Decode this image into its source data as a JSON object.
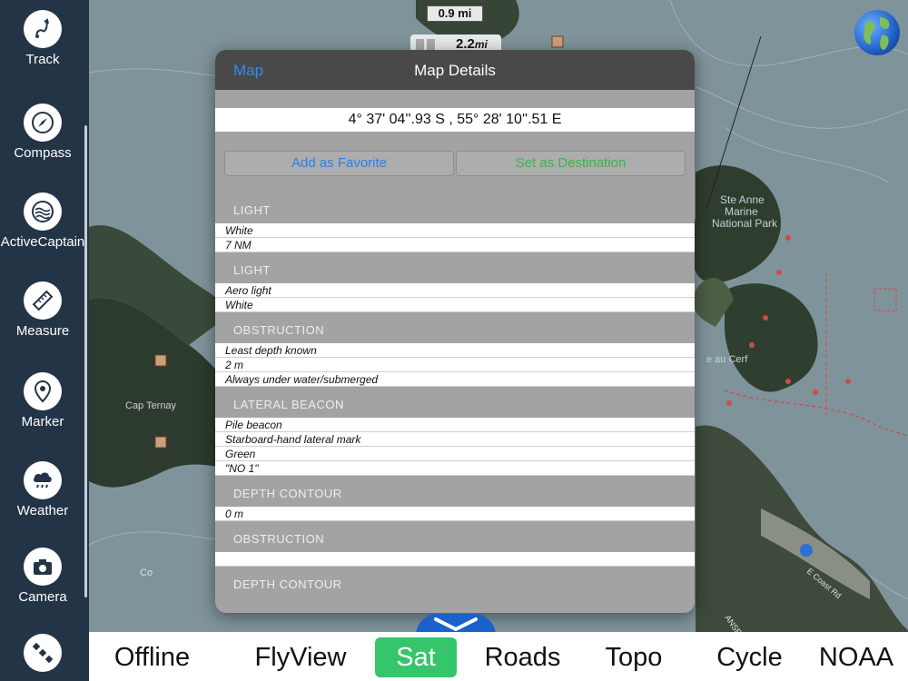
{
  "sidebar": {
    "items": [
      {
        "label": "Track",
        "icon": "track-icon"
      },
      {
        "label": "Compass",
        "icon": "compass-icon"
      },
      {
        "label": "ActiveCaptain",
        "icon": "activecaptain-icon"
      },
      {
        "label": "Measure",
        "icon": "ruler-icon"
      },
      {
        "label": "Marker",
        "icon": "map-pin-icon"
      },
      {
        "label": "Weather",
        "icon": "rain-cloud-icon"
      },
      {
        "label": "Camera",
        "icon": "camera-icon"
      },
      {
        "label": "",
        "icon": "satellite-icon"
      }
    ]
  },
  "map": {
    "scale_top": "0.9 mi",
    "scale_value": "2.2",
    "scale_unit": "mi",
    "labels": {
      "ste_anne": "Ste Anne",
      "marine": "Marine",
      "national_park": "National Park",
      "cap_ternay": "Cap Ternay",
      "au_cerf": "e au Cerf",
      "co": "Co",
      "east_coast_rd": "E Coast Rd",
      "anse": "ANSE R"
    }
  },
  "dialog": {
    "back_label": "Map",
    "title": "Map Details",
    "coordinates": "4° 37' 04''.93 S  ,  55° 28' 10''.51 E",
    "add_favorite_label": "Add as Favorite",
    "set_destination_label": "Set as Destination",
    "sections": [
      {
        "header": "LIGHT",
        "rows": [
          "White",
          "7 NM"
        ]
      },
      {
        "header": "LIGHT",
        "rows": [
          "Aero light",
          "White"
        ]
      },
      {
        "header": "OBSTRUCTION",
        "rows": [
          "Least depth known",
          "2 m",
          "Always under water/submerged"
        ]
      },
      {
        "header": "LATERAL BEACON",
        "rows": [
          "Pile beacon",
          "Starboard-hand lateral mark",
          "Green",
          "\"NO 1\""
        ]
      },
      {
        "header": "DEPTH CONTOUR",
        "rows": [
          "0 m"
        ]
      },
      {
        "header": "OBSTRUCTION",
        "rows": [
          ""
        ]
      },
      {
        "header": "DEPTH CONTOUR",
        "rows": []
      }
    ]
  },
  "maptypes": {
    "items": [
      "Offline",
      "FlyView",
      "Sat",
      "Roads",
      "Topo",
      "Cycle",
      "NOAA"
    ],
    "selected": "Sat"
  },
  "colors": {
    "sidebar_bg": "#243447",
    "accent_blue": "#2d8cf0",
    "destination_green": "#3cb54a",
    "selected_maptype": "#35c56a"
  }
}
